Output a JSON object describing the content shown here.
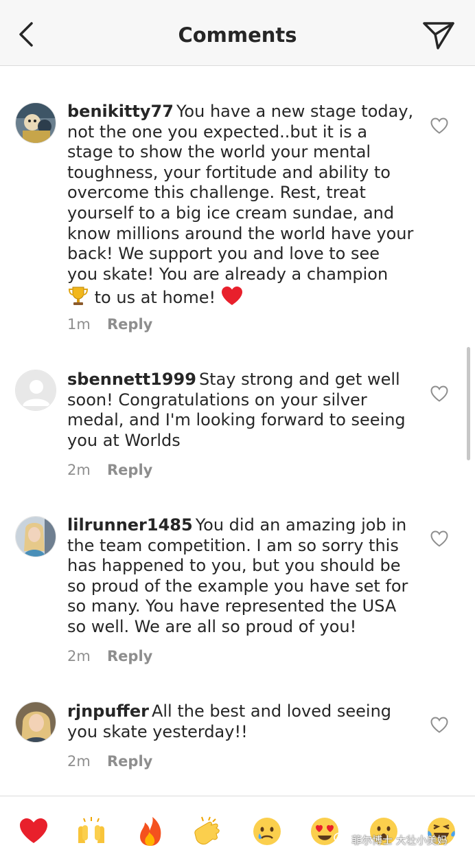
{
  "header": {
    "title": "Comments",
    "back_icon": "chevron-left-icon",
    "send_icon": "paper-plane-icon"
  },
  "comments": [
    {
      "username": "benikitty77",
      "text_a": "You have a new stage today, not the one you expected..but it is a stage to show the world your mental toughness, your fortitude and ability to overcome this challenge. Rest, treat yourself to a big ice cream sundae, and know millions around the world have your back! We support you and love to see you skate! You are already a champion",
      "text_b": "to us at home!",
      "emoji_a": "trophy-emoji",
      "emoji_b": "red-heart-emoji",
      "time": "1m",
      "reply": "Reply"
    },
    {
      "username": "sbennett1999",
      "text_a": "Stay strong and get well soon! Congratulations on your silver medal, and I'm looking forward to seeing you at Worlds",
      "time": "2m",
      "reply": "Reply"
    },
    {
      "username": "lilrunner1485",
      "text_a": "You did an amazing job in the team competition. I am so sorry this has happened to you, but you should be so proud of the example you have set for so many. You have represented the USA so well. We are all so proud of you!",
      "time": "2m",
      "reply": "Reply"
    },
    {
      "username": "rjnpuffer",
      "text_a": "All the best and loved seeing you skate yesterday!!",
      "time": "2m",
      "reply": "Reply"
    }
  ],
  "reactions": [
    "red-heart-emoji",
    "raising-hands-emoji",
    "fire-emoji",
    "clapping-hands-emoji",
    "crying-face-emoji",
    "heart-eyes-emoji",
    "surprised-face-emoji",
    "tears-of-joy-emoji"
  ],
  "watermark": "菲尔博士 大壮小美妈",
  "colors": {
    "text": "#262626",
    "secondary": "#8e8e8e",
    "header_bg": "#f7f7f7",
    "divider": "#dbdbdb",
    "heart_red": "#e8202c"
  }
}
